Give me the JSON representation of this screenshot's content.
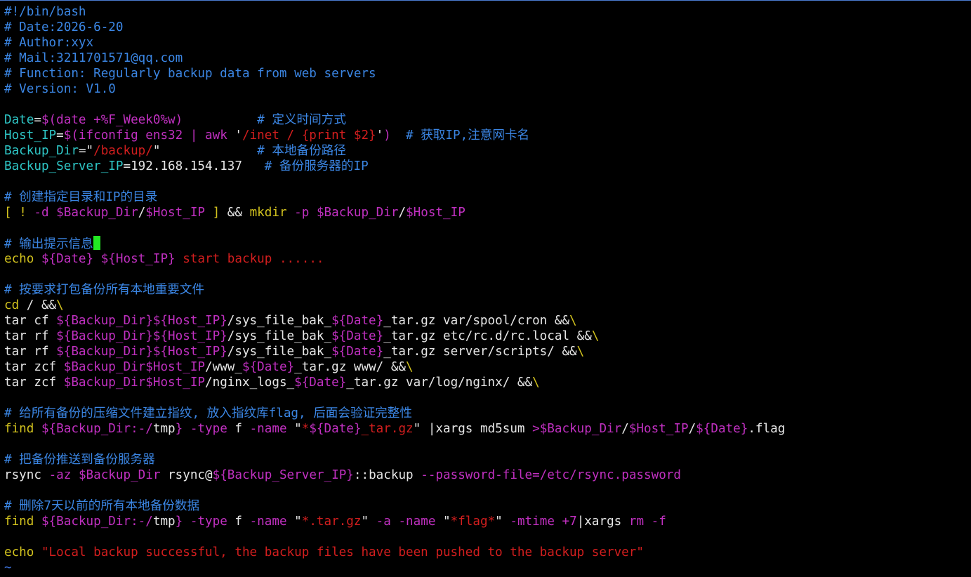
{
  "colors": {
    "background": "#000000",
    "comment": "#3b86e4",
    "variable": "#2ec6c6",
    "special": "#c030c0",
    "string": "#d21e1e",
    "keyword": "#d2c21e",
    "plain": "#e6e6e6",
    "cursor": "#22e722",
    "tilde": "#3b6fd6"
  },
  "editor": {
    "cursor_line": 15,
    "tilde": "~",
    "lines": [
      [
        [
          "c",
          "#!/bin/bash"
        ]
      ],
      [
        [
          "c",
          "# Date:2026-6-20"
        ]
      ],
      [
        [
          "c",
          "# Author:xyx"
        ]
      ],
      [
        [
          "c",
          "# Mail:3211701571@qq.com"
        ]
      ],
      [
        [
          "c",
          "# Function: Regularly backup data from web servers"
        ]
      ],
      [
        [
          "c",
          "# Version: V1.0"
        ]
      ],
      [],
      [
        [
          "v",
          "Date"
        ],
        [
          "p",
          "="
        ],
        [
          "m",
          "$(date +%F_Week0%w)"
        ],
        [
          "p",
          "          "
        ],
        [
          "c",
          "# 定义时间方式"
        ]
      ],
      [
        [
          "v",
          "Host_IP"
        ],
        [
          "p",
          "="
        ],
        [
          "m",
          "$(ifconfig ens32 | awk "
        ],
        [
          "p",
          "'"
        ],
        [
          "r",
          "/inet / {print $2}"
        ],
        [
          "p",
          "'"
        ],
        [
          "m",
          ")"
        ],
        [
          "p",
          "  "
        ],
        [
          "c",
          "# 获取IP,注意网卡名"
        ]
      ],
      [
        [
          "v",
          "Backup_Dir"
        ],
        [
          "p",
          "=\""
        ],
        [
          "r",
          "/backup/"
        ],
        [
          "p",
          "\""
        ],
        [
          "p",
          "             "
        ],
        [
          "c",
          "# 本地备份路径"
        ]
      ],
      [
        [
          "v",
          "Backup_Server_IP"
        ],
        [
          "p",
          "=192.168.154.137   "
        ],
        [
          "c",
          "# 备份服务器的IP"
        ]
      ],
      [],
      [
        [
          "c",
          "# 创建指定目录和IP的目录"
        ]
      ],
      [
        [
          "y",
          "[ "
        ],
        [
          "y",
          "!"
        ],
        [
          "p",
          " "
        ],
        [
          "m",
          "-d"
        ],
        [
          "p",
          " "
        ],
        [
          "m",
          "$Backup_Dir"
        ],
        [
          "p",
          "/"
        ],
        [
          "m",
          "$Host_IP"
        ],
        [
          "p",
          " "
        ],
        [
          "y",
          "]"
        ],
        [
          "p",
          " && "
        ],
        [
          "y",
          "mkdir"
        ],
        [
          "p",
          " "
        ],
        [
          "m",
          "-p"
        ],
        [
          "p",
          " "
        ],
        [
          "m",
          "$Backup_Dir"
        ],
        [
          "p",
          "/"
        ],
        [
          "m",
          "$Host_IP"
        ]
      ],
      [],
      [
        [
          "c",
          "# 输出提示信息"
        ]
      ],
      [
        [
          "y",
          "echo"
        ],
        [
          "p",
          " "
        ],
        [
          "m",
          "${Date}"
        ],
        [
          "p",
          " "
        ],
        [
          "m",
          "${Host_IP}"
        ],
        [
          "p",
          " "
        ],
        [
          "r",
          "start backup ......"
        ]
      ],
      [],
      [
        [
          "c",
          "# 按要求打包备份所有本地重要文件"
        ]
      ],
      [
        [
          "y",
          "cd"
        ],
        [
          "p",
          " / &&"
        ],
        [
          "y",
          "\\"
        ]
      ],
      [
        [
          "p",
          "tar cf "
        ],
        [
          "m",
          "${Backup_Dir}${Host_IP}"
        ],
        [
          "p",
          "/sys_file_bak_"
        ],
        [
          "m",
          "${Date}"
        ],
        [
          "p",
          "_tar.gz var/spool/cron &&"
        ],
        [
          "y",
          "\\"
        ]
      ],
      [
        [
          "p",
          "tar rf "
        ],
        [
          "m",
          "${Backup_Dir}${Host_IP}"
        ],
        [
          "p",
          "/sys_file_bak_"
        ],
        [
          "m",
          "${Date}"
        ],
        [
          "p",
          "_tar.gz etc/rc.d/rc.local &&"
        ],
        [
          "y",
          "\\"
        ]
      ],
      [
        [
          "p",
          "tar rf "
        ],
        [
          "m",
          "${Backup_Dir}${Host_IP}"
        ],
        [
          "p",
          "/sys_file_bak_"
        ],
        [
          "m",
          "${Date}"
        ],
        [
          "p",
          "_tar.gz server/scripts/ &&"
        ],
        [
          "y",
          "\\"
        ]
      ],
      [
        [
          "p",
          "tar zcf "
        ],
        [
          "m",
          "$Backup_Dir$Host_IP"
        ],
        [
          "p",
          "/www_"
        ],
        [
          "m",
          "${Date}"
        ],
        [
          "p",
          "_tar.gz www/ &&"
        ],
        [
          "y",
          "\\"
        ]
      ],
      [
        [
          "p",
          "tar zcf "
        ],
        [
          "m",
          "$Backup_Dir$Host_IP"
        ],
        [
          "p",
          "/nginx_logs_"
        ],
        [
          "m",
          "${Date}"
        ],
        [
          "p",
          "_tar.gz var/log/nginx/ &&"
        ],
        [
          "y",
          "\\"
        ]
      ],
      [],
      [
        [
          "c",
          "# 给所有备份的压缩文件建立指纹, 放入指纹库flag, 后面会验证完整性"
        ]
      ],
      [
        [
          "y",
          "find"
        ],
        [
          "p",
          " "
        ],
        [
          "m",
          "${Backup_Dir:-/"
        ],
        [
          "p",
          "tmp"
        ],
        [
          "m",
          "}"
        ],
        [
          "p",
          " "
        ],
        [
          "m",
          "-type"
        ],
        [
          "p",
          " f "
        ],
        [
          "m",
          "-name"
        ],
        [
          "p",
          " \""
        ],
        [
          "r",
          "*"
        ],
        [
          "m",
          "${Date}"
        ],
        [
          "r",
          "_tar.gz"
        ],
        [
          "p",
          "\" |xargs md5sum "
        ],
        [
          "m",
          ">$Backup_Dir"
        ],
        [
          "p",
          "/"
        ],
        [
          "m",
          "$Host_IP"
        ],
        [
          "p",
          "/"
        ],
        [
          "m",
          "${Date}"
        ],
        [
          "p",
          ".flag"
        ]
      ],
      [],
      [
        [
          "c",
          "# 把备份推送到备份服务器"
        ]
      ],
      [
        [
          "p",
          "rsync "
        ],
        [
          "m",
          "-az"
        ],
        [
          "p",
          " "
        ],
        [
          "m",
          "$Backup_Dir"
        ],
        [
          "p",
          " rsync@"
        ],
        [
          "m",
          "${Backup_Server_IP}"
        ],
        [
          "p",
          "::backup "
        ],
        [
          "m",
          "--password-file=/etc/rsync.password"
        ]
      ],
      [],
      [
        [
          "c",
          "# 删除7天以前的所有本地备份数据"
        ]
      ],
      [
        [
          "y",
          "find"
        ],
        [
          "p",
          " "
        ],
        [
          "m",
          "${Backup_Dir:-/"
        ],
        [
          "p",
          "tmp"
        ],
        [
          "m",
          "}"
        ],
        [
          "p",
          " "
        ],
        [
          "m",
          "-type"
        ],
        [
          "p",
          " f "
        ],
        [
          "m",
          "-name"
        ],
        [
          "p",
          " \""
        ],
        [
          "r",
          "*.tar.gz"
        ],
        [
          "p",
          "\" "
        ],
        [
          "m",
          "-a"
        ],
        [
          "p",
          " "
        ],
        [
          "m",
          "-name"
        ],
        [
          "p",
          " \""
        ],
        [
          "r",
          "*flag*"
        ],
        [
          "p",
          "\" "
        ],
        [
          "m",
          "-mtime"
        ],
        [
          "p",
          " "
        ],
        [
          "m",
          "+7"
        ],
        [
          "p",
          "|xargs "
        ],
        [
          "m",
          "rm"
        ],
        [
          "p",
          " "
        ],
        [
          "m",
          "-f"
        ]
      ],
      [],
      [
        [
          "y",
          "echo"
        ],
        [
          "p",
          " "
        ],
        [
          "r",
          "\"Local backup successful, the backup files have been pushed to the backup server\""
        ]
      ]
    ]
  }
}
